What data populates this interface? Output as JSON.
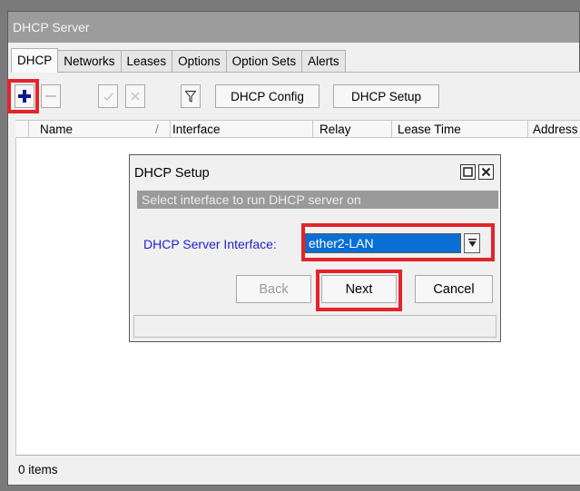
{
  "window": {
    "title": "DHCP Server"
  },
  "tabs": [
    {
      "label": "DHCP",
      "active": true
    },
    {
      "label": "Networks"
    },
    {
      "label": "Leases"
    },
    {
      "label": "Options"
    },
    {
      "label": "Option Sets"
    },
    {
      "label": "Alerts"
    }
  ],
  "toolbar": {
    "add_icon": "plus-icon",
    "remove_icon": "minus-icon",
    "enable_icon": "check-icon",
    "disable_icon": "x-icon",
    "filter_icon": "filter-icon",
    "dhcp_config_label": "DHCP Config",
    "dhcp_setup_label": "DHCP Setup"
  },
  "table": {
    "columns": [
      "Name",
      "Interface",
      "Relay",
      "Lease Time",
      "Address"
    ],
    "sort_indicator": "/"
  },
  "status": {
    "items_label": "0 items"
  },
  "dialog": {
    "title": "DHCP Setup",
    "description": "Select interface to run DHCP server on",
    "field_label": "DHCP Server Interface:",
    "field_value": "ether2-LAN",
    "back_label": "Back",
    "next_label": "Next",
    "cancel_label": "Cancel"
  },
  "colors": {
    "highlight": "#e3242b",
    "selection": "#0a6fd4",
    "field_label": "#1f1fcf"
  }
}
